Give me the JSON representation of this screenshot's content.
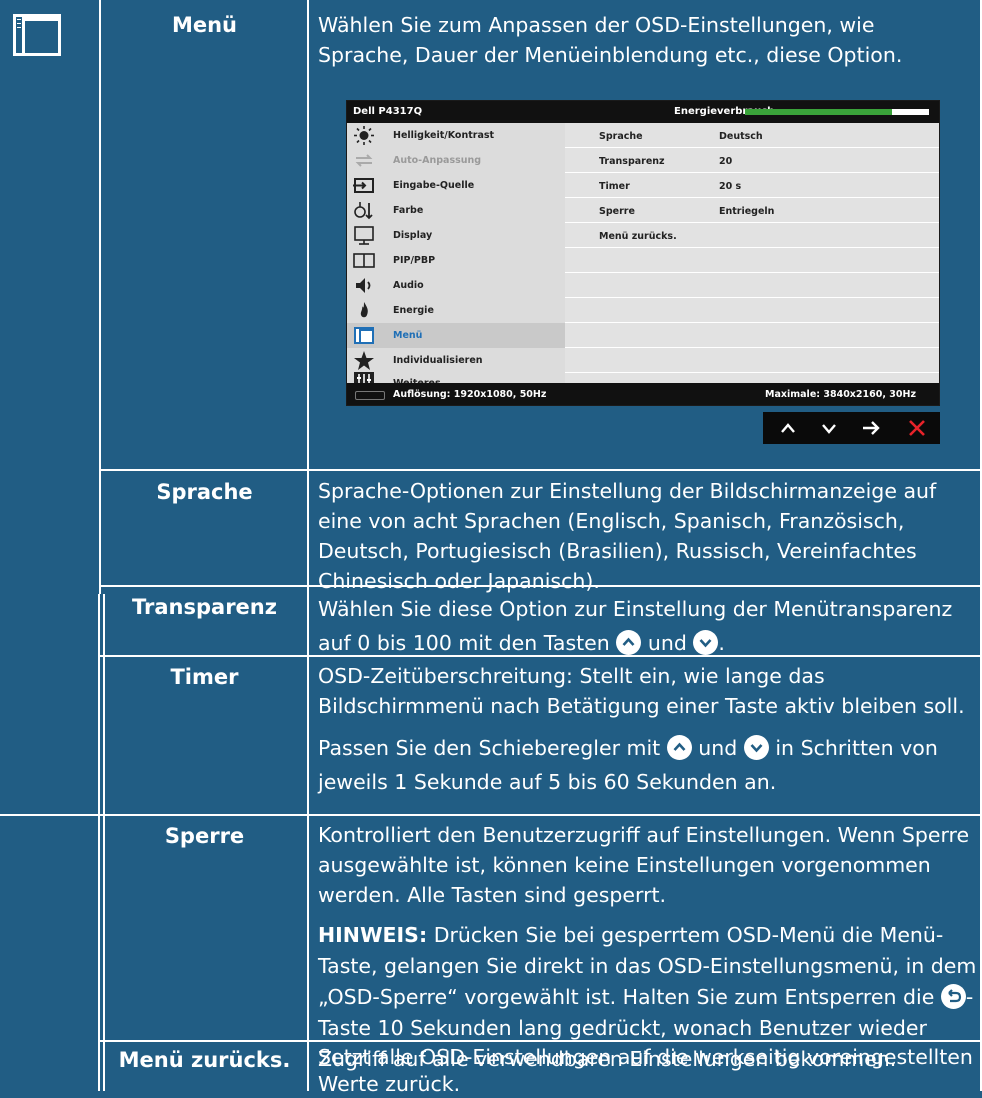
{
  "colors": {
    "background": "#215d84",
    "text": "#ffffff",
    "osd_header": "#111111",
    "osd_selected": "#1f6fb6",
    "close_red": "#e8232a"
  },
  "section_icon": "menu-window-icon",
  "rows": [
    {
      "name": "Menü",
      "desc": [
        "Wählen Sie zum Anpassen der OSD-Einstellungen, wie Sprache, Dauer der Menüeinblendung etc., diese Option."
      ]
    },
    {
      "name": "Sprache",
      "desc": [
        "Sprache-Optionen zur Einstellung der Bildschirmanzeige auf eine von acht Sprachen (Englisch, Spanisch, Französisch, Deutsch, Portugiesisch (Brasilien), Russisch, Vereinfachtes Chinesisch oder Japanisch)."
      ]
    },
    {
      "name": "Transparenz",
      "desc_a": "Wählen Sie diese Option zur Einstellung der Menütransparenz auf 0 bis 100 mit den Tasten",
      "desc_b": "und",
      "desc_c": "."
    },
    {
      "name": "Timer",
      "p1": "OSD-Zeitüberschreitung: Stellt ein, wie lange das Bildschirmmenü nach Betätigung einer Taste aktiv bleiben soll.",
      "p2_a": "Passen Sie den Schieberegler mit",
      "p2_b": "und",
      "p2_c": "in Schritten von jeweils 1 Sekunde auf 5 bis 60 Sekunden an."
    },
    {
      "name": "Sperre",
      "p1": "Kontrolliert den Benutzerzugriff auf Einstellungen. Wenn Sperre ausgewählte ist, können keine Einstellungen vorgenommen werden. Alle Tasten sind gesperrt.",
      "note_label": "HINWEIS:",
      "note_a": "Drücken Sie bei gesperrtem OSD-Menü die Menü-Taste, gelangen Sie direkt in das OSD-Einstellungsmenü, in dem „OSD-Sperre“ vorgewählt ist. Halten Sie zum Entsperren die",
      "note_b": "-Taste 10 Sekunden lang gedrückt, wonach Benutzer wieder Zugriff auf alle verwendbaren Einstellungen bekommen."
    },
    {
      "name": "Menü zurücks.",
      "desc": [
        "Setzt alle OSD-Einstellungen auf die werkseitig voreingestellten Werte zurück."
      ]
    }
  ],
  "osd": {
    "model": "Dell P4317Q",
    "energy_label": "Energieverbrauch",
    "energy_level": 0.8,
    "menu": [
      {
        "label": "Helligkeit/Kontrast",
        "icon": "brightness-icon"
      },
      {
        "label": "Auto-Anpassung",
        "icon": "auto-adjust-icon",
        "disabled": true
      },
      {
        "label": "Eingabe-Quelle",
        "icon": "input-source-icon"
      },
      {
        "label": "Farbe",
        "icon": "color-icon"
      },
      {
        "label": "Display",
        "icon": "display-icon"
      },
      {
        "label": "PIP/PBP",
        "icon": "pip-pbp-icon"
      },
      {
        "label": "Audio",
        "icon": "audio-icon"
      },
      {
        "label": "Energie",
        "icon": "energy-icon"
      },
      {
        "label": "Menü",
        "icon": "menu-icon",
        "selected": true
      },
      {
        "label": "Individualisieren",
        "icon": "star-icon"
      },
      {
        "label": "Weiteres",
        "icon": "others-icon"
      }
    ],
    "settings": [
      {
        "key": "Sprache",
        "value": "Deutsch"
      },
      {
        "key": "Transparenz",
        "value": "20"
      },
      {
        "key": "Timer",
        "value": "20 s"
      },
      {
        "key": "Sperre",
        "value": "Entriegeln"
      },
      {
        "key": "Menü zurücks.",
        "value": ""
      }
    ],
    "resolution": "Auflösung: 1920x1080, 50Hz",
    "maximum": "Maximale: 3840x2160, 30Hz",
    "nav_buttons": [
      "up-icon",
      "down-icon",
      "right-arrow-icon",
      "close-icon"
    ]
  }
}
